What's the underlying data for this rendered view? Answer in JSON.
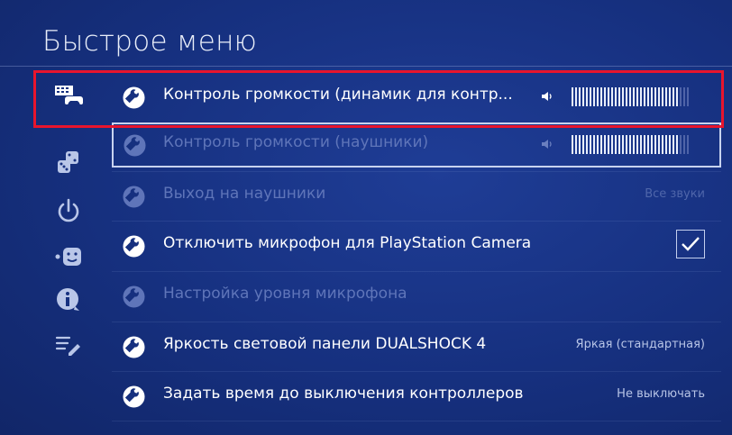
{
  "title": "Быстрое меню",
  "sidebar": {
    "icons": [
      "controller-keyboard-icon",
      "dice-icon",
      "power-icon",
      "face-icon",
      "info-icon",
      "list-edit-icon"
    ]
  },
  "rows": [
    {
      "label": "Контроль громкости (динамик для контр...",
      "type": "volume",
      "enabled": true,
      "volume_level": 0.92
    },
    {
      "label": "Контроль громкости (наушники)",
      "type": "volume",
      "enabled": false,
      "selected": true,
      "volume_level": 0.92
    },
    {
      "label": "Выход на наушники",
      "value": "Все звуки",
      "enabled": false
    },
    {
      "label": "Отключить микрофон для PlayStation Camera",
      "type": "checkbox",
      "checked": true,
      "enabled": true
    },
    {
      "label": "Настройка уровня микрофона",
      "enabled": false
    },
    {
      "label": "Яркость световой панели DUALSHOCK 4",
      "value": "Яркая (стандартная)",
      "enabled": true
    },
    {
      "label": "Задать время до выключения контроллеров",
      "value": "Не выключать",
      "enabled": true
    }
  ],
  "colors": {
    "background": "#16307f",
    "highlight_border": "#e8152d",
    "dim_text": "#5f75b9"
  }
}
